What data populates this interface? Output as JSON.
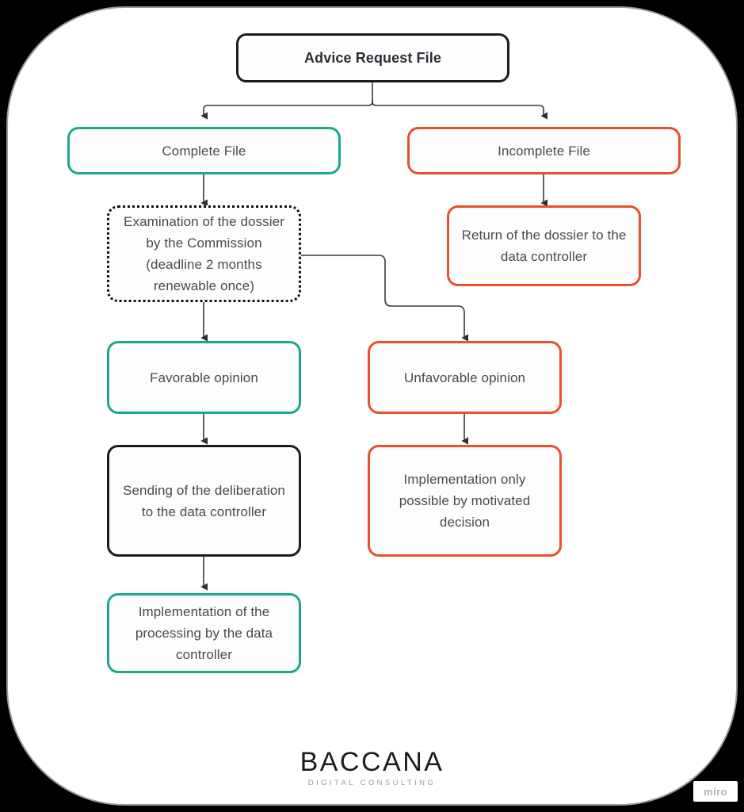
{
  "diagram": {
    "title_node": {
      "label": "Advice Request File"
    },
    "nodes": [
      {
        "id": "complete-file",
        "label": "Complete File",
        "style": "green"
      },
      {
        "id": "incomplete-file",
        "label": "Incomplete File",
        "style": "red"
      },
      {
        "id": "examination",
        "label": "Examination of the dossier by the Commission (deadline 2 months renewable once)",
        "style": "dotted"
      },
      {
        "id": "return-dossier",
        "label": "Return of the dossier to the data controller",
        "style": "red"
      },
      {
        "id": "favorable-opinion",
        "label": "Favorable opinion",
        "style": "green"
      },
      {
        "id": "unfavorable-opinion",
        "label": "Unfavorable opinion",
        "style": "red"
      },
      {
        "id": "sending-deliberation",
        "label": "Sending of the deliberation to the data controller",
        "style": "black"
      },
      {
        "id": "implementation-motivated",
        "label": "Implementation only possible by motivated decision",
        "style": "red"
      },
      {
        "id": "implementation-processing",
        "label": "Implementation of the processing by the data controller",
        "style": "green"
      }
    ]
  },
  "footer": {
    "logo_wordmark": "BACCANA",
    "logo_tagline": "DIGITAL CONSULTING"
  },
  "watermark": {
    "label": "miro"
  },
  "colors": {
    "green": "#1ba98b",
    "red": "#e8502e",
    "black": "#1d1d1d",
    "text": "#4a4a4a",
    "connector": "#3a3a3a",
    "page_background": "#000000",
    "card_background": "#ffffff"
  }
}
